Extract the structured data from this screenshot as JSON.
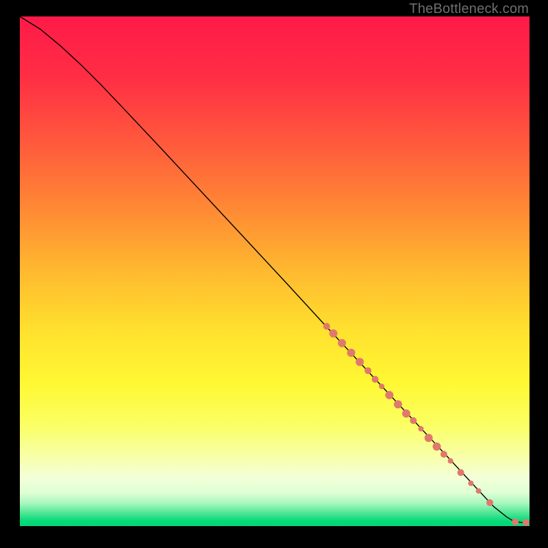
{
  "watermark": "TheBottleneck.com",
  "chart_data": {
    "type": "line",
    "title": "",
    "xlabel": "",
    "ylabel": "",
    "xlim": [
      0,
      100
    ],
    "ylim": [
      0,
      100
    ],
    "grid": false,
    "legend": false,
    "gradient_stops": [
      {
        "pos": 0.0,
        "color": "#ff1a49"
      },
      {
        "pos": 0.12,
        "color": "#ff2e44"
      },
      {
        "pos": 0.25,
        "color": "#ff5a3c"
      },
      {
        "pos": 0.38,
        "color": "#ff8a34"
      },
      {
        "pos": 0.5,
        "color": "#ffb92f"
      },
      {
        "pos": 0.62,
        "color": "#ffe22e"
      },
      {
        "pos": 0.72,
        "color": "#fff833"
      },
      {
        "pos": 0.8,
        "color": "#fbff62"
      },
      {
        "pos": 0.87,
        "color": "#f7ffb0"
      },
      {
        "pos": 0.905,
        "color": "#f3ffd8"
      },
      {
        "pos": 0.935,
        "color": "#deffd4"
      },
      {
        "pos": 0.955,
        "color": "#a8f7bf"
      },
      {
        "pos": 0.975,
        "color": "#4be693"
      },
      {
        "pos": 0.99,
        "color": "#07d979"
      },
      {
        "pos": 1.0,
        "color": "#05d877"
      }
    ],
    "series": [
      {
        "name": "curve",
        "stroke": "#000000",
        "x": [
          0,
          4,
          8,
          12,
          16,
          20,
          28,
          36,
          44,
          52,
          60,
          68,
          76,
          84,
          90,
          93,
          95.5,
          97,
          98.5,
          100
        ],
        "y": [
          100,
          97.5,
          94.2,
          90.5,
          86.5,
          82.3,
          73.8,
          65.2,
          56.6,
          48.0,
          39.3,
          30.7,
          22.1,
          13.5,
          7.0,
          3.8,
          1.8,
          0.9,
          0.7,
          0.7
        ]
      }
    ],
    "markers": {
      "color": "#e1786e",
      "points": [
        {
          "x": 60.2,
          "y": 39.2,
          "r": 5
        },
        {
          "x": 61.5,
          "y": 37.8,
          "r": 6
        },
        {
          "x": 63.2,
          "y": 35.9,
          "r": 6
        },
        {
          "x": 65.0,
          "y": 34.0,
          "r": 6
        },
        {
          "x": 66.7,
          "y": 32.2,
          "r": 6
        },
        {
          "x": 68.3,
          "y": 30.5,
          "r": 5
        },
        {
          "x": 69.7,
          "y": 28.8,
          "r": 5
        },
        {
          "x": 71.0,
          "y": 27.4,
          "r": 4
        },
        {
          "x": 72.5,
          "y": 25.7,
          "r": 6
        },
        {
          "x": 74.2,
          "y": 23.9,
          "r": 6
        },
        {
          "x": 75.8,
          "y": 22.1,
          "r": 6
        },
        {
          "x": 77.2,
          "y": 20.7,
          "r": 5
        },
        {
          "x": 78.7,
          "y": 19.1,
          "r": 4
        },
        {
          "x": 80.2,
          "y": 17.3,
          "r": 6
        },
        {
          "x": 81.8,
          "y": 15.6,
          "r": 6
        },
        {
          "x": 83.2,
          "y": 14.1,
          "r": 5
        },
        {
          "x": 84.5,
          "y": 12.8,
          "r": 4
        },
        {
          "x": 86.5,
          "y": 10.5,
          "r": 5
        },
        {
          "x": 88.5,
          "y": 8.4,
          "r": 4
        },
        {
          "x": 90.0,
          "y": 6.9,
          "r": 4
        },
        {
          "x": 92.2,
          "y": 4.6,
          "r": 5
        },
        {
          "x": 97.2,
          "y": 0.8,
          "r": 5
        },
        {
          "x": 99.3,
          "y": 0.7,
          "r": 5
        }
      ]
    }
  }
}
